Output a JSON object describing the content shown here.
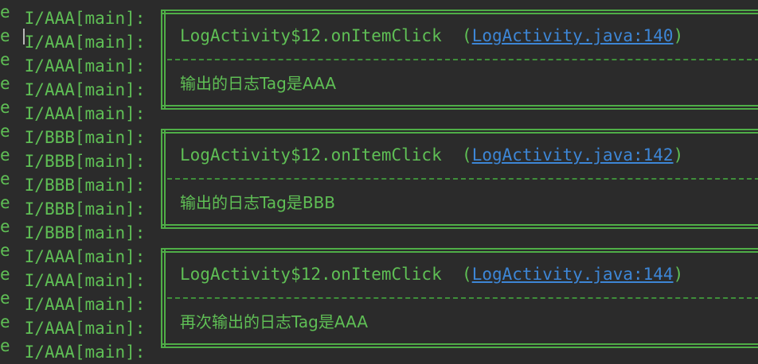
{
  "console": {
    "prefix": "e",
    "rows": [
      {
        "tag": "I/AAA[main]:"
      },
      {
        "tag": "I/AAA[main]:"
      },
      {
        "tag": "I/AAA[main]:"
      },
      {
        "tag": "I/AAA[main]:"
      },
      {
        "tag": "I/AAA[main]:"
      },
      {
        "tag": "I/BBB[main]:"
      },
      {
        "tag": "I/BBB[main]:"
      },
      {
        "tag": "I/BBB[main]:"
      },
      {
        "tag": "I/BBB[main]:"
      },
      {
        "tag": "I/BBB[main]:"
      },
      {
        "tag": "I/AAA[main]:"
      },
      {
        "tag": "I/AAA[main]:"
      },
      {
        "tag": "I/AAA[main]:"
      },
      {
        "tag": "I/AAA[main]:"
      },
      {
        "tag": "I/AAA[main]:"
      }
    ],
    "blocks": [
      {
        "method": "LogActivity$12.onItemClick",
        "paren_open": "(",
        "link": "LogActivity.java:140",
        "paren_close": ")",
        "message": "输出的日志Tag是AAA"
      },
      {
        "method": "LogActivity$12.onItemClick",
        "paren_open": "(",
        "link": "LogActivity.java:142",
        "paren_close": ")",
        "message": "输出的日志Tag是BBB"
      },
      {
        "method": "LogActivity$12.onItemClick",
        "paren_open": "(",
        "link": "LogActivity.java:144",
        "paren_close": ")",
        "message": "再次输出的日志Tag是AAA"
      }
    ]
  },
  "colors": {
    "background": "#2b2b2b",
    "log_green": "#5fbf55",
    "link_blue": "#3d86d6"
  }
}
